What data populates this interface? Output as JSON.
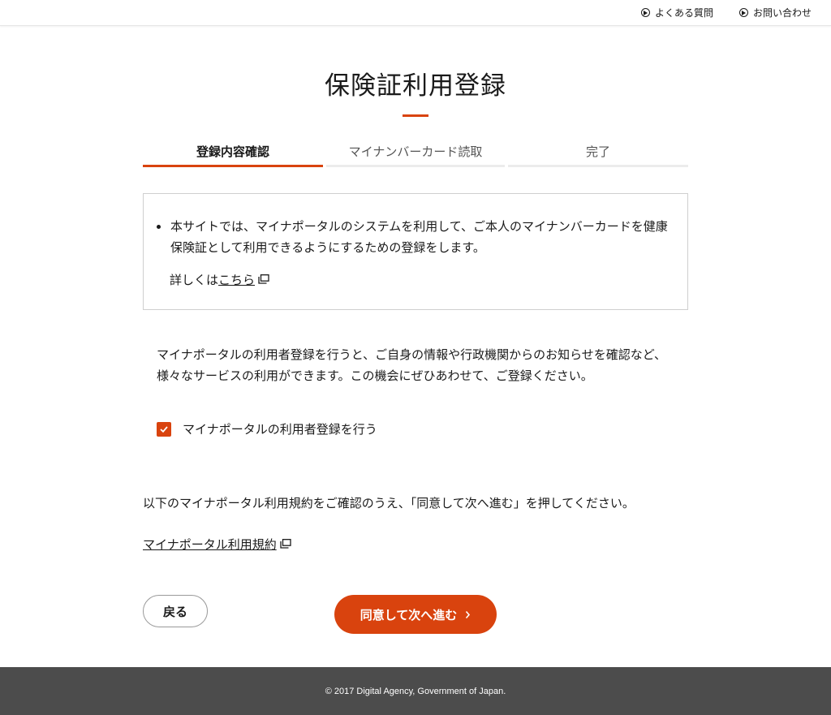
{
  "header": {
    "faq_label": "よくある質問",
    "contact_label": "お問い合わせ"
  },
  "page": {
    "title": "保険証利用登録"
  },
  "steps": [
    {
      "label": "登録内容確認",
      "active": true
    },
    {
      "label": "マイナンバーカード読取",
      "active": false
    },
    {
      "label": "完了",
      "active": false
    }
  ],
  "info": {
    "bullet_text": "本サイトでは、マイナポータルのシステムを利用して、ご本人のマイナンバーカードを健康保険証として利用できるようにするための登録をします。",
    "more_prefix": "詳しくは",
    "more_link": "こちら"
  },
  "registration": {
    "description": "マイナポータルの利用者登録を行うと、ご自身の情報や行政機関からのお知らせを確認など、様々なサービスの利用ができます。この機会にぜひあわせて、ご登録ください。",
    "checkbox_label": "マイナポータルの利用者登録を行う",
    "checked": true
  },
  "terms": {
    "text": "以下のマイナポータル利用規約をご確認のうえ、「同意して次へ進む」を押してください。",
    "link": "マイナポータル利用規約"
  },
  "buttons": {
    "back": "戻る",
    "next": "同意して次へ進む"
  },
  "footer": {
    "copyright": "© 2017 Digital Agency, Government of Japan."
  },
  "colors": {
    "accent": "#d9430e",
    "footer_bg": "#4c4c4c"
  }
}
